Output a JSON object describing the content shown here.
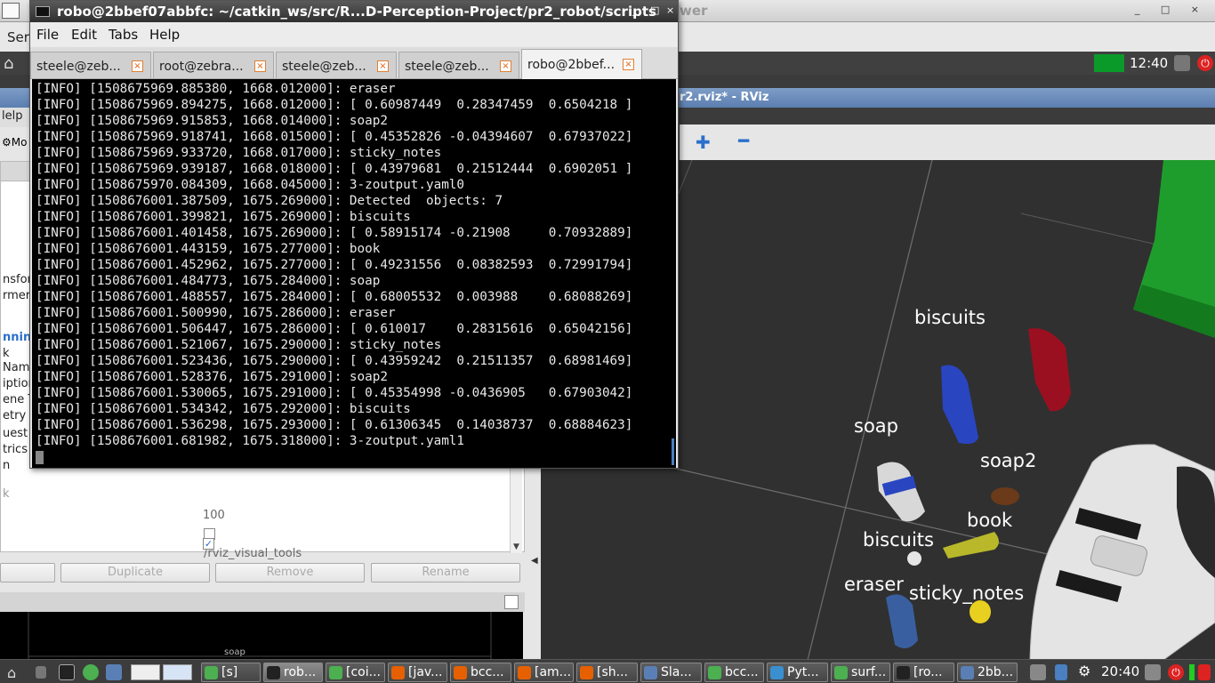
{
  "back_window": {
    "title_tail": "wer",
    "menu_first": "Ser",
    "winbtns": "_ □ ×"
  },
  "desktop_topbar": {
    "clock": "12:40"
  },
  "rviz": {
    "title": "r2.rviz* - RViz",
    "left_strip_label": "lelp",
    "toolbar_move": "Mo",
    "props": [
      {
        "label": "nsfor",
        "style": "normal"
      },
      {
        "label": "rmer",
        "style": "normal"
      },
      {
        "label": "nnin",
        "style": "blue"
      },
      {
        "label": "k",
        "style": "normal"
      },
      {
        "label": "Nam",
        "style": "normal"
      },
      {
        "label": "iption",
        "style": "normal"
      },
      {
        "label": "ene T",
        "style": "normal"
      },
      {
        "label": "etry",
        "style": "normal"
      },
      {
        "label": "uest",
        "style": "normal"
      },
      {
        "label": "trics",
        "style": "normal"
      },
      {
        "label": "n",
        "style": "normal"
      },
      {
        "label": "k",
        "style": "gray"
      }
    ],
    "prop_value_topic": "/rviz_visual_tools",
    "prop_value_num": "100",
    "check_mark": "✓",
    "buttons": {
      "duplicate": "Duplicate",
      "remove": "Remove",
      "rename": "Rename"
    },
    "mini_view_label": "soap",
    "object_labels": [
      "biscuits",
      "soap",
      "soap2",
      "book",
      "biscuits",
      "eraser",
      "sticky_notes"
    ]
  },
  "terminal": {
    "title": "robo@2bbef07abbfc: ~/catkin_ws/src/R...D-Perception-Project/pr2_robot/scripts",
    "winbtns": [
      "_",
      "□",
      "×"
    ],
    "menu": [
      "File",
      "Edit",
      "Tabs",
      "Help"
    ],
    "tabs": [
      {
        "label": "steele@zeb...",
        "active": false
      },
      {
        "label": "root@zebra...",
        "active": false
      },
      {
        "label": "steele@zeb...",
        "active": false
      },
      {
        "label": "steele@zeb...",
        "active": false
      },
      {
        "label": "robo@2bbef...",
        "active": true
      }
    ],
    "tab_close": "×",
    "lines": [
      "[INFO] [1508675969.885380, 1668.012000]: eraser",
      "[INFO] [1508675969.894275, 1668.012000]: [ 0.60987449  0.28347459  0.6504218 ]",
      "[INFO] [1508675969.915853, 1668.014000]: soap2",
      "[INFO] [1508675969.918741, 1668.015000]: [ 0.45352826 -0.04394607  0.67937022]",
      "[INFO] [1508675969.933720, 1668.017000]: sticky_notes",
      "[INFO] [1508675969.939187, 1668.018000]: [ 0.43979681  0.21512444  0.6902051 ]",
      "[INFO] [1508675970.084309, 1668.045000]: 3-zoutput.yaml0",
      "[INFO] [1508676001.387509, 1675.269000]: Detected  objects: 7",
      "[INFO] [1508676001.399821, 1675.269000]: biscuits",
      "[INFO] [1508676001.401458, 1675.269000]: [ 0.58915174 -0.21908     0.70932889]",
      "[INFO] [1508676001.443159, 1675.277000]: book",
      "[INFO] [1508676001.452962, 1675.277000]: [ 0.49231556  0.08382593  0.72991794]",
      "[INFO] [1508676001.484773, 1675.284000]: soap",
      "[INFO] [1508676001.488557, 1675.284000]: [ 0.68005532  0.003988    0.68088269]",
      "[INFO] [1508676001.500990, 1675.286000]: eraser",
      "[INFO] [1508676001.506447, 1675.286000]: [ 0.610017    0.28315616  0.65042156]",
      "[INFO] [1508676001.521067, 1675.290000]: sticky_notes",
      "[INFO] [1508676001.523436, 1675.290000]: [ 0.43959242  0.21511357  0.68981469]",
      "[INFO] [1508676001.528376, 1675.291000]: soap2",
      "[INFO] [1508676001.530065, 1675.291000]: [ 0.45354998 -0.0436905   0.67903042]",
      "[INFO] [1508676001.534342, 1675.292000]: biscuits",
      "[INFO] [1508676001.536298, 1675.293000]: [ 0.61306345  0.14038737  0.68884623]",
      "[INFO] [1508676001.681982, 1675.318000]: 3-zoutput.yaml1"
    ]
  },
  "taskbar": {
    "items": [
      {
        "label": "[s]",
        "icon": "leaf-icon",
        "color": "#4caf50",
        "active": false
      },
      {
        "label": "rob...",
        "icon": "terminal-icon",
        "color": "#222222",
        "active": true
      },
      {
        "label": "[coi...",
        "icon": "leaf-icon",
        "color": "#4caf50",
        "active": false
      },
      {
        "label": "[jav...",
        "icon": "firefox-icon",
        "color": "#e66000",
        "active": false
      },
      {
        "label": "bcc...",
        "icon": "firefox-icon",
        "color": "#e66000",
        "active": false
      },
      {
        "label": "[am...",
        "icon": "firefox-icon",
        "color": "#e66000",
        "active": false
      },
      {
        "label": "[sh...",
        "icon": "firefox-icon",
        "color": "#e66000",
        "active": false
      },
      {
        "label": "Sla...",
        "icon": "window-icon",
        "color": "#5a7fb5",
        "active": false
      },
      {
        "label": "bcc...",
        "icon": "leaf-icon",
        "color": "#4caf50",
        "active": false
      },
      {
        "label": "Pyt...",
        "icon": "python-icon",
        "color": "#3a8fd0",
        "active": false
      },
      {
        "label": "surf...",
        "icon": "leaf-icon",
        "color": "#4caf50",
        "active": false
      },
      {
        "label": "[ro...",
        "icon": "terminal-icon",
        "color": "#222222",
        "active": false
      },
      {
        "label": "2bb...",
        "icon": "window-icon",
        "color": "#5a7fb5",
        "active": false
      }
    ],
    "clock": "20:40"
  }
}
